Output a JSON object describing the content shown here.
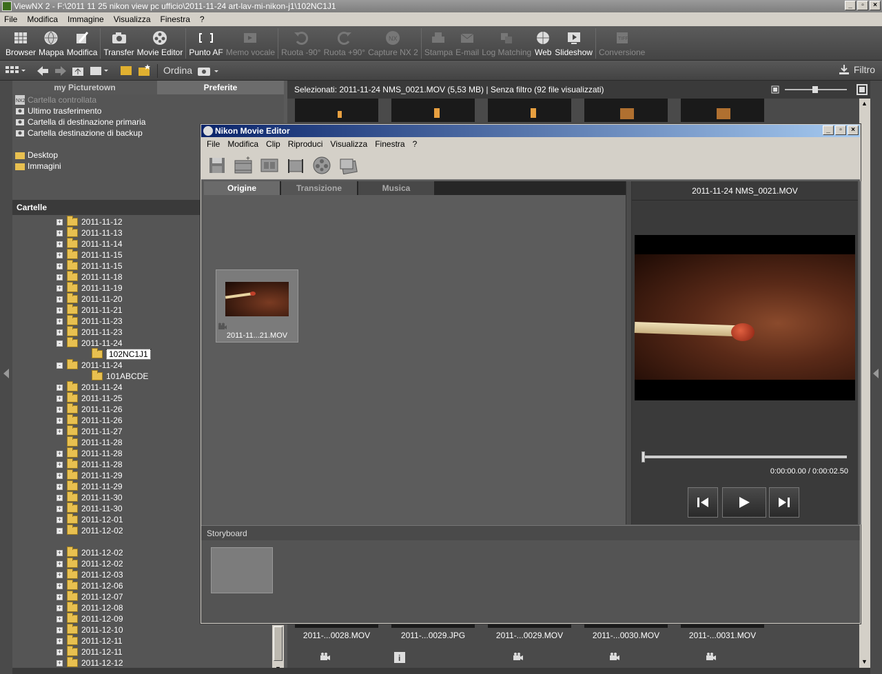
{
  "window": {
    "title": "ViewNX 2 - F:\\2011 11 25 nikon view pc ufficio\\2011-11-24 art-lav-mi-nikon-j1\\102NC1J1"
  },
  "menu": [
    "File",
    "Modifica",
    "Immagine",
    "Visualizza",
    "Finestra",
    "?"
  ],
  "toolbar": [
    {
      "label": "Browser",
      "icon": "grid-icon",
      "enabled": true
    },
    {
      "label": "Mappa",
      "icon": "globe-icon",
      "enabled": true
    },
    {
      "label": "Modifica",
      "icon": "edit-icon",
      "enabled": true
    },
    {
      "label": "Transfer",
      "icon": "camera-icon",
      "enabled": true
    },
    {
      "label": "Movie Editor",
      "icon": "film-reel-icon",
      "enabled": true
    },
    {
      "label": "Punto AF",
      "icon": "af-point-icon",
      "enabled": true
    },
    {
      "label": "Memo vocale",
      "icon": "voice-memo-icon",
      "enabled": false
    },
    {
      "label": "Ruota -90°",
      "icon": "rotate-left-icon",
      "enabled": false
    },
    {
      "label": "Ruota +90°",
      "icon": "rotate-right-icon",
      "enabled": false
    },
    {
      "label": "Capture NX 2",
      "icon": "capture-nx-icon",
      "enabled": false
    },
    {
      "label": "Stampa",
      "icon": "print-icon",
      "enabled": false
    },
    {
      "label": "E-mail",
      "icon": "mail-icon",
      "enabled": false
    },
    {
      "label": "Log Matching",
      "icon": "log-matching-icon",
      "enabled": false
    },
    {
      "label": "Web",
      "icon": "web-icon",
      "enabled": true
    },
    {
      "label": "Slideshow",
      "icon": "slideshow-icon",
      "enabled": true
    },
    {
      "label": "Conversione",
      "icon": "convert-icon",
      "enabled": false
    }
  ],
  "toolbar2": {
    "sort_label": "Ordina",
    "filter_label": "Filtro"
  },
  "left_panel": {
    "tabs": [
      "my Picturetown",
      "Preferite"
    ],
    "favorites": [
      "Cartella controllata",
      "Ultimo trasferimento",
      "Cartella di destinazione primaria",
      "Cartella destinazione di backup"
    ],
    "locations": [
      "Desktop",
      "Immagini"
    ],
    "folders_header": "Cartelle",
    "folders": [
      {
        "name": "2011-11-12",
        "sign": "+",
        "level": 0
      },
      {
        "name": "2011-11-13",
        "sign": "+",
        "level": 0
      },
      {
        "name": "2011-11-14",
        "sign": "+",
        "level": 0
      },
      {
        "name": "2011-11-15",
        "sign": "+",
        "level": 0
      },
      {
        "name": "2011-11-15",
        "sign": "+",
        "level": 0
      },
      {
        "name": "2011-11-18",
        "sign": "+",
        "level": 0
      },
      {
        "name": "2011-11-19",
        "sign": "+",
        "level": 0
      },
      {
        "name": "2011-11-20",
        "sign": "+",
        "level": 0
      },
      {
        "name": "2011-11-21",
        "sign": "+",
        "level": 0
      },
      {
        "name": "2011-11-23",
        "sign": "+",
        "level": 0
      },
      {
        "name": "2011-11-23",
        "sign": "+",
        "level": 0
      },
      {
        "name": "2011-11-24",
        "sign": "-",
        "level": 0
      },
      {
        "name": "102NC1J1",
        "sign": "",
        "level": 1,
        "selected": true
      },
      {
        "name": "2011-11-24",
        "sign": "-",
        "level": 0
      },
      {
        "name": "101ABCDE",
        "sign": "",
        "level": 1
      },
      {
        "name": "2011-11-24",
        "sign": "+",
        "level": 0
      },
      {
        "name": "2011-11-25",
        "sign": "+",
        "level": 0
      },
      {
        "name": "2011-11-26",
        "sign": "+",
        "level": 0
      },
      {
        "name": "2011-11-26",
        "sign": "+",
        "level": 0
      },
      {
        "name": "2011-11-27",
        "sign": "+",
        "level": 0
      },
      {
        "name": "2011-11-28",
        "sign": "",
        "level": 0
      },
      {
        "name": "2011-11-28",
        "sign": "+",
        "level": 0
      },
      {
        "name": "2011-11-28",
        "sign": "+",
        "level": 0
      },
      {
        "name": "2011-11-29",
        "sign": "+",
        "level": 0
      },
      {
        "name": "2011-11-29",
        "sign": "+",
        "level": 0
      },
      {
        "name": "2011-11-30",
        "sign": "+",
        "level": 0
      },
      {
        "name": "2011-11-30",
        "sign": "+",
        "level": 0
      },
      {
        "name": "2011-12-01",
        "sign": "+",
        "level": 0
      },
      {
        "name": "2011-12-02",
        "sign": "-",
        "level": 0
      },
      {
        "name": "",
        "sign": "",
        "level": 1
      },
      {
        "name": "2011-12-02",
        "sign": "+",
        "level": 0
      },
      {
        "name": "2011-12-02",
        "sign": "+",
        "level": 0
      },
      {
        "name": "2011-12-03",
        "sign": "+",
        "level": 0
      },
      {
        "name": "2011-12-06",
        "sign": "+",
        "level": 0
      },
      {
        "name": "2011-12-07",
        "sign": "+",
        "level": 0
      },
      {
        "name": "2011-12-08",
        "sign": "+",
        "level": 0
      },
      {
        "name": "2011-12-09",
        "sign": "+",
        "level": 0
      },
      {
        "name": "2011-12-10",
        "sign": "+",
        "level": 0
      },
      {
        "name": "2011-12-11",
        "sign": "+",
        "level": 0
      },
      {
        "name": "2011-12-11",
        "sign": "+",
        "level": 0
      },
      {
        "name": "2011-12-12",
        "sign": "+",
        "level": 0
      }
    ]
  },
  "browser": {
    "status": "Selezionati: 2011-11-24 NMS_0021.MOV (5,53 MB) | Senza filtro  (92 file visualizzati)",
    "bottom_thumbs": [
      "2011-...0028.MOV",
      "2011-...0029.JPG",
      "2011-...0029.MOV",
      "2011-...0030.MOV",
      "2011-...0031.MOV"
    ]
  },
  "movie_editor": {
    "title": "Nikon Movie Editor",
    "menu": [
      "File",
      "Modifica",
      "Clip",
      "Riproduci",
      "Visualizza",
      "Finestra",
      "?"
    ],
    "toolbar_icons": [
      "save-icon",
      "new-clip-icon",
      "storyboard-icon",
      "trim-icon",
      "film-reel-icon",
      "export-icon"
    ],
    "tabs": [
      "Origine",
      "Transizione",
      "Musica"
    ],
    "clip_label": "2011-11...21.MOV",
    "preview_title": "2011-11-24 NMS_0021.MOV",
    "time": "0:00:00.00 / 0:00:02.50",
    "seek_progress": 0,
    "storyboard_label": "Storyboard"
  }
}
